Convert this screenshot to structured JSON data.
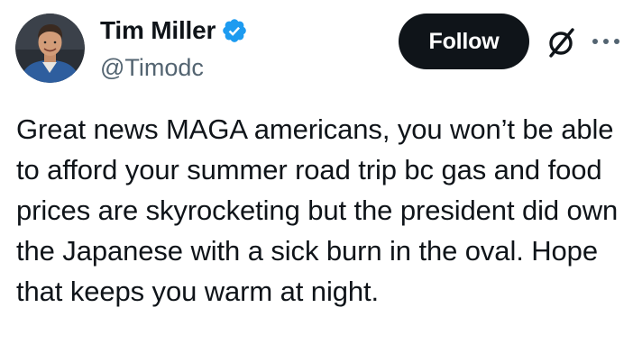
{
  "author": {
    "display_name": "Tim Miller",
    "handle": "@Timodc",
    "verified": true,
    "avatar_icon": "profile-photo"
  },
  "actions": {
    "follow_label": "Follow",
    "grok_icon": "grok-slash-circle-icon",
    "more_icon": "more-horizontal-icon"
  },
  "tweet": {
    "text": "Great news MAGA americans, you won’t be able to afford your summer road trip bc gas and food prices are skyrocketing but the president did own the Japanese with a sick burn in the oval. Hope that keeps you warm at night."
  },
  "colors": {
    "text_primary": "#0f1419",
    "text_secondary": "#536471",
    "verified_blue": "#1d9bf0",
    "follow_bg": "#0f1419",
    "follow_text": "#ffffff"
  }
}
